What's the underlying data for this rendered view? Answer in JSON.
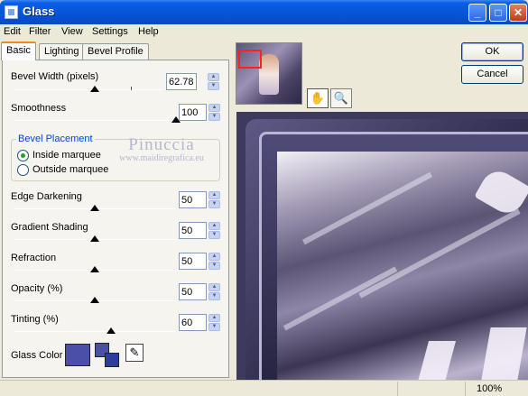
{
  "window": {
    "title": "Glass"
  },
  "menu": [
    "Edit",
    "Filter",
    "View",
    "Settings",
    "Help"
  ],
  "tabs": [
    "Basic",
    "Lighting",
    "Bevel Profile"
  ],
  "controls": {
    "bevel_width": {
      "label": "Bevel Width (pixels)",
      "value": "62.78",
      "slider_fraction": 0.54
    },
    "smoothness": {
      "label": "Smoothness",
      "value": "100",
      "slider_fraction": 1.0
    },
    "edge_darkening": {
      "label": "Edge Darkening",
      "value": "50",
      "slider_fraction": 0.5
    },
    "gradient_shading": {
      "label": "Gradient Shading",
      "value": "50",
      "slider_fraction": 0.5
    },
    "refraction": {
      "label": "Refraction",
      "value": "50",
      "slider_fraction": 0.5
    },
    "opacity": {
      "label": "Opacity (%)",
      "value": "50",
      "slider_fraction": 0.5
    },
    "tinting": {
      "label": "Tinting (%)",
      "value": "60",
      "slider_fraction": 0.6
    }
  },
  "bevel_placement": {
    "title": "Bevel Placement",
    "options": [
      "Inside marquee",
      "Outside marquee"
    ],
    "selected": "Inside marquee"
  },
  "glass_color": {
    "label": "Glass Color",
    "color": "#4b4fa8",
    "fg": "#4b4fa8",
    "bg": "#2e3ca0"
  },
  "buttons": {
    "ok": "OK",
    "cancel": "Cancel"
  },
  "watermark": {
    "line1": "Pinuccia",
    "line2": "www.maidiregrafica.eu"
  },
  "status": {
    "zoom": "100%"
  }
}
